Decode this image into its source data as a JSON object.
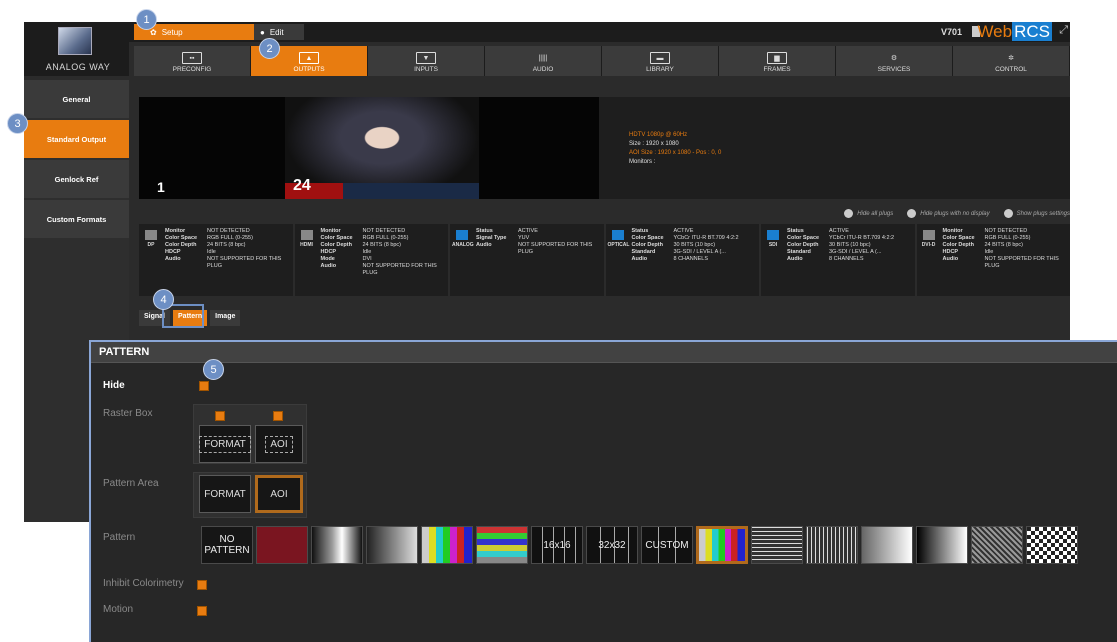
{
  "app": {
    "logo_text": "ANALOG WAY",
    "version": "V701",
    "brand_web": "Web",
    "brand_rcs": "RCS"
  },
  "mode_tabs": [
    {
      "label": "Setup",
      "active": true
    },
    {
      "label": "Edit",
      "active": false
    }
  ],
  "nav": [
    {
      "label": "PRECONFIG",
      "icon": "preconfig-icon",
      "active": false
    },
    {
      "label": "OUTPUTS",
      "icon": "outputs-icon",
      "active": true
    },
    {
      "label": "INPUTS",
      "icon": "inputs-icon",
      "active": false
    },
    {
      "label": "AUDIO",
      "icon": "audio-icon",
      "active": false
    },
    {
      "label": "LIBRARY",
      "icon": "library-icon",
      "active": false
    },
    {
      "label": "FRAMES",
      "icon": "frames-icon",
      "active": false
    },
    {
      "label": "SERVICES",
      "icon": "services-icon",
      "active": false
    },
    {
      "label": "CONTROL",
      "icon": "control-icon",
      "active": false
    }
  ],
  "sidebar": [
    {
      "label": "General",
      "active": false
    },
    {
      "label": "Standard Output",
      "active": true
    },
    {
      "label": "Genlock Ref",
      "active": false
    },
    {
      "label": "Custom Formats",
      "active": false
    }
  ],
  "preview": {
    "output_number": "1",
    "channel": "24",
    "format": "HDTV 1080p @ 60Hz",
    "size": "Size : 1920 x 1080",
    "aoi": "AOI Size : 1920 x 1080 - Pos : 0, 0",
    "monitors": "Monitors :"
  },
  "plug_actions": {
    "hide_all": "Hide all plugs",
    "hide_no_display": "Hide plugs with no display",
    "show_settings": "Show plugs settings"
  },
  "plugs": [
    {
      "type": "DP",
      "rows": [
        [
          "Monitor",
          "NOT DETECTED"
        ],
        [
          "Color Space",
          "RGB FULL (0-255)"
        ],
        [
          "Color Depth",
          "24 BITS (8 bpc)"
        ],
        [
          "",
          ""
        ],
        [
          "HDCP",
          "Idle"
        ],
        [
          "",
          ""
        ],
        [
          "Audio",
          "NOT SUPPORTED FOR THIS PLUG"
        ]
      ]
    },
    {
      "type": "HDMI",
      "rows": [
        [
          "Monitor",
          "NOT DETECTED"
        ],
        [
          "Color Space",
          "RGB FULL (0-255)"
        ],
        [
          "Color Depth",
          "24 BITS (8 bpc)"
        ],
        [
          "",
          ""
        ],
        [
          "HDCP",
          "Idle"
        ],
        [
          "Mode",
          "DVI"
        ],
        [
          "Audio",
          "NOT SUPPORTED FOR THIS PLUG"
        ]
      ]
    },
    {
      "type": "ANALOG",
      "rows": [
        [
          "Status",
          "ACTIVE"
        ],
        [
          "Signal Type",
          "YUV"
        ],
        [
          "",
          ""
        ],
        [
          "",
          ""
        ],
        [
          "",
          ""
        ],
        [
          "",
          ""
        ],
        [
          "Audio",
          "NOT SUPPORTED FOR THIS PLUG"
        ]
      ]
    },
    {
      "type": "OPTICAL",
      "rows": [
        [
          "Status",
          "ACTIVE"
        ],
        [
          "Color Space",
          "YCbCr ITU-R BT.709 4:2:2"
        ],
        [
          "Color Depth",
          "30 BITS (10 bpc)"
        ],
        [
          "Standard",
          "3G-SDI / LEVEL A (..."
        ],
        [
          "",
          ""
        ],
        [
          "",
          ""
        ],
        [
          "Audio",
          "8 CHANNELS"
        ]
      ]
    },
    {
      "type": "SDI",
      "rows": [
        [
          "Status",
          "ACTIVE"
        ],
        [
          "Color Space",
          "YCbCr ITU-R BT.709 4:2:2"
        ],
        [
          "Color Depth",
          "30 BITS (10 bpc)"
        ],
        [
          "Standard",
          "3G-SDI / LEVEL A (..."
        ],
        [
          "",
          ""
        ],
        [
          "",
          ""
        ],
        [
          "Audio",
          "8 CHANNELS"
        ]
      ]
    },
    {
      "type": "DVI-D",
      "rows": [
        [
          "Monitor",
          "NOT DETECTED"
        ],
        [
          "Color Space",
          "RGB FULL (0-255)"
        ],
        [
          "Color Depth",
          "24 BITS (8 bpc)"
        ],
        [
          "",
          ""
        ],
        [
          "HDCP",
          "Idle"
        ],
        [
          "",
          ""
        ],
        [
          "Audio",
          "NOT SUPPORTED FOR THIS PLUG"
        ]
      ]
    }
  ],
  "subtabs": [
    {
      "label": "Signal",
      "active": false
    },
    {
      "label": "Pattern",
      "active": true
    },
    {
      "label": "Image",
      "active": false
    }
  ],
  "callouts": [
    "1",
    "2",
    "3",
    "4",
    "5"
  ],
  "panel": {
    "title": "PATTERN",
    "hide_label": "Hide",
    "raster_box_label": "Raster Box",
    "raster_format": "FORMAT",
    "raster_aoi": "AOI",
    "pattern_area_label": "Pattern Area",
    "area_format": "FORMAT",
    "area_aoi": "AOI",
    "pattern_label": "Pattern",
    "patterns": [
      "NO PATTERN",
      "",
      "",
      "",
      "",
      "",
      "16x16",
      "32x32",
      "CUSTOM",
      "",
      "",
      "",
      "",
      "",
      "",
      ""
    ],
    "inhibit_label": "Inhibit Colorimetry",
    "motion_label": "Motion"
  }
}
